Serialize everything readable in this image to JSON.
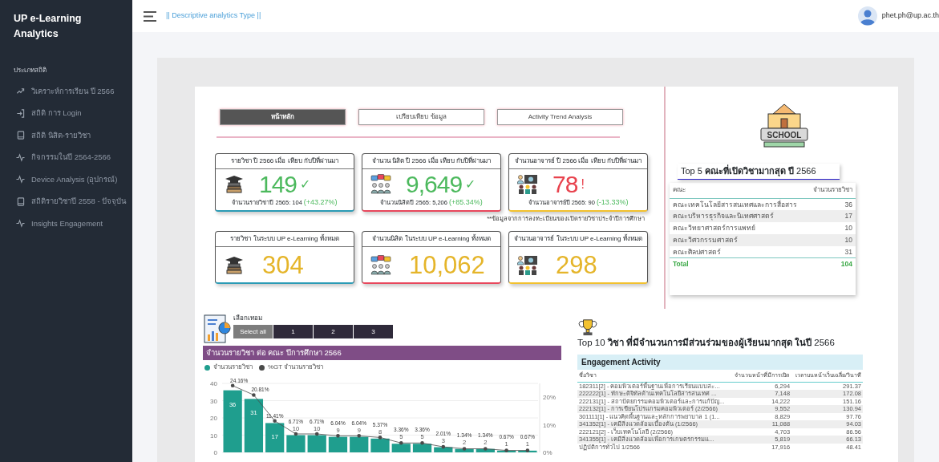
{
  "sidebar": {
    "title": "UP e-Learning Analytics",
    "section": "ประเภทสถิติ",
    "items": [
      {
        "label": "วิเคราะห์การเรียน ปี 2566",
        "selected": false
      },
      {
        "label": "สถิติ การ Login",
        "selected": false
      },
      {
        "label": "สถิติ นิสิต-รายวิชา",
        "selected": false
      },
      {
        "label": "กิจกรรมในปี 2564-2566",
        "selected": false
      },
      {
        "label": "Device Analysis (อุปกรณ์)",
        "selected": false
      },
      {
        "label": "สถิติรายวิชาปี 2558 - ปัจจุบัน",
        "selected": false
      },
      {
        "label": "Insights Engagement",
        "selected": false
      }
    ]
  },
  "header": {
    "subtitle": "|| Descriptive analytics Type ||",
    "user": "phet.ph@up.ac.th"
  },
  "nav_buttons": [
    {
      "label": "หน้าหลัก",
      "selected": true
    },
    {
      "label": "เปรียบเทียบ ข้อมูล",
      "selected": false
    },
    {
      "label": "Activity Trend Analysis",
      "selected": false
    }
  ],
  "compare_cards": [
    {
      "title": "รายวิชา ปี 2566 เมื่อ เทียบ กับปีที่ผ่านมา",
      "value": "149",
      "sign": "✓",
      "kind": "increase",
      "note": "จำนวนรายวิชาปี 2565: 104",
      "change": "(+43.27%)",
      "color": "#2b9bb5"
    },
    {
      "title": "จำนวน นิสิต  ปี 2566 เมื่อ เทียบ กับปีที่ผ่านมา",
      "value": "9,649",
      "sign": "✓",
      "kind": "increase",
      "note": "จำนวนนิสิตปี 2565: 5,206",
      "change": "(+85.34%)",
      "color": "#e8475c"
    },
    {
      "title": "จำนวนอาจารย์ ปี 2566 เมื่อ เทียบ กับปีที่ผ่านมา",
      "value": "78",
      "sign": "!",
      "kind": "decrease",
      "note": "จำนวนอาจารย์ปี 2565: 90",
      "change": "(-13.33%)",
      "color": "#f2c12e"
    }
  ],
  "footnote": "**ข้อมูลจากการลงทะเบียนของเปิดรายวิชาประจำปีการศึกษา",
  "total_cards": [
    {
      "title": "รายวิชา ในระบบ UP e-Learning ทั้งหมด",
      "value": "304",
      "color": "#2b9bb5"
    },
    {
      "title": "จำนวนนิสิต ในระบบ UP e-Learning ทั้งหมด",
      "value": "10,062",
      "color": "#e8475c"
    },
    {
      "title": "จำนวนอาจารย์ ในระบบ UP e-Learning ทั้งหมด",
      "value": "298",
      "color": "#f2c12e"
    }
  ],
  "school_badge": "SCHOOL",
  "top_faculties": {
    "title": "Top 5 **คณะที่เปิดวิชามากสุด ปี** 2566",
    "columns": [
      "คณะ",
      "จำนวนรายวิชา"
    ],
    "rows": [
      [
        "คณะเทคโนโลยีสารสนเทศและการสื่อสาร",
        "36"
      ],
      [
        "คณะบริหารธุรกิจและนิเทศศาสตร์",
        "17"
      ],
      [
        "คณะวิทยาศาสตร์การแพทย์",
        "10"
      ],
      [
        "คณะวิศวกรรมศาสตร์",
        "10"
      ],
      [
        "คณะศิลปศาสตร์",
        "31"
      ]
    ],
    "total": [
      "Total",
      "104"
    ]
  },
  "semester_filter": {
    "label": "เลือกเทอม",
    "options": [
      {
        "label": "Select all",
        "selected": true
      },
      {
        "label": "1",
        "selected": false
      },
      {
        "label": "2",
        "selected": false
      },
      {
        "label": "3",
        "selected": false
      }
    ]
  },
  "faculty_chart": {
    "title": "จำนวนรายวิชา ต่อ คณะ ปีการศึกษา 2566",
    "chart_data": {
      "type": "bar",
      "ylim": [
        0,
        40
      ],
      "yticks": [
        0,
        10,
        20,
        30,
        40
      ],
      "grid": true,
      "data_labels": true,
      "series": [
        {
          "name": "จำนวนรายวิชา",
          "color": "#1f9e8e",
          "values": [
            36,
            31,
            17,
            10,
            10,
            9,
            9,
            8,
            5,
            5,
            3,
            2,
            2,
            1,
            1
          ]
        }
      ]
    },
    "percent_line": {
      "chart_data": {
        "type": "line",
        "ylim": [
          0,
          25
        ],
        "yticks": [
          {
            "value": 0,
            "label": "0%"
          },
          {
            "value": 10,
            "label": "10%"
          },
          {
            "value": 20,
            "label": "20%"
          }
        ],
        "series": [
          {
            "name": "%GT จำนวนรายวิชา",
            "color": "#4a4a4a",
            "values": [
              24.2,
              20.8,
              11.4,
              6.7,
              6.7,
              6.0,
              6.0,
              5.4,
              3.4,
              3.4,
              2.0,
              1.3,
              1.3,
              0.7,
              0.7
            ]
          }
        ],
        "value_labels": [
          "24.16%",
          "20.81%",
          "11.41%",
          "6.71%",
          "6.71%",
          "6.04%",
          "6.04%",
          "5.37%",
          "3.36%",
          "3.36%",
          "2.01%",
          "1.34%",
          "1.34%",
          "0.67%",
          "0.67%"
        ]
      }
    }
  },
  "top_courses": {
    "title": "Top 10 **วิชา ที่มีจำนวนการมีส่วนร่วมของผู้เรียนมากสุด ในปี** 2566",
    "table_title": "Engagement Activity",
    "columns": [
      "ชื่อวิชา",
      "จำนวนหน้าที่มีการเปิด",
      "เวลาบนหน้าเว็บเฉลี่ย/วินาที"
    ],
    "rows": [
      [
        "182311[2] - คอมพิวเตอร์พื้นฐานเพื่อการเรียนแบบสะ...",
        "6,294",
        "291.37"
      ],
      [
        "222222[1] - ทักษะดิจิทัลด้านเทคโนโลยีสารสนเทศ ...",
        "7,148",
        "172.08"
      ],
      [
        "222131[1] - สถาปัตยกรรมคอมพิวเตอร์และการแก้ปัญ...",
        "14,222",
        "151.16"
      ],
      [
        "222132[1] - การเขียนโปรแกรมคอมพิวเตอร์ (2/2566)",
        "9,552",
        "130.94"
      ],
      [
        "301111[1] - แนวคิดพื้นฐานและหลักการพยาบาล 1 (1...",
        "8,829",
        "97.76"
      ],
      [
        "341352[1] - เคมีสิ่งแวดล้อมเบื้องต้น (1/2566)",
        "11,088",
        "94.03"
      ],
      [
        "222121[2] - เว็บเทคโนโลยี (2/2566)",
        "4,703",
        "86.56"
      ],
      [
        "341355[1] - เคมีสิ่งแวดล้อมเพื่อการเกษตรกรรมแ...",
        "5,819",
        "66.13"
      ],
      [
        "ปฏิบัติการทั่วไป 1/2566",
        "17,916",
        "48.41"
      ]
    ]
  }
}
